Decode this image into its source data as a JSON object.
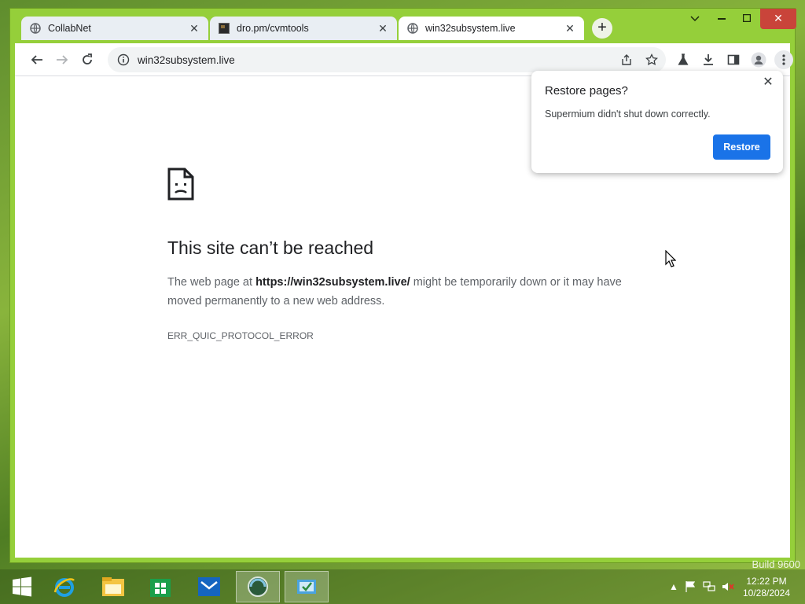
{
  "browser": {
    "tabs": [
      {
        "title": "CollabNet",
        "active": false,
        "favicon": "globe-icon"
      },
      {
        "title": "dro.pm/cvmtools",
        "active": false,
        "favicon": "site-thumbnail-icon"
      },
      {
        "title": "win32subsystem.live",
        "active": true,
        "favicon": "globe-icon"
      }
    ],
    "new_tab_label": "+",
    "omnibox": {
      "url": "win32subsystem.live"
    }
  },
  "error_page": {
    "title": "This site can’t be reached",
    "body_prefix": "The web page at ",
    "body_url": "https://win32subsystem.live/",
    "body_suffix": " might be temporarily down or it may have moved permanently to a new web address.",
    "code": "ERR_QUIC_PROTOCOL_ERROR"
  },
  "restore_bubble": {
    "title": "Restore pages?",
    "message": "Supermium didn't shut down correctly.",
    "button": "Restore"
  },
  "taskbar": {
    "apps": [
      "start-icon",
      "internet-explorer-icon",
      "file-explorer-icon",
      "store-icon",
      "mail-icon",
      "browser-globe-icon",
      "task-app-icon"
    ],
    "clock_time": "12:22 PM",
    "clock_date": "10/28/2024",
    "watermark": "Build 9600"
  },
  "colors": {
    "accent": "#1a73e8",
    "frame": "#95cf3a"
  }
}
